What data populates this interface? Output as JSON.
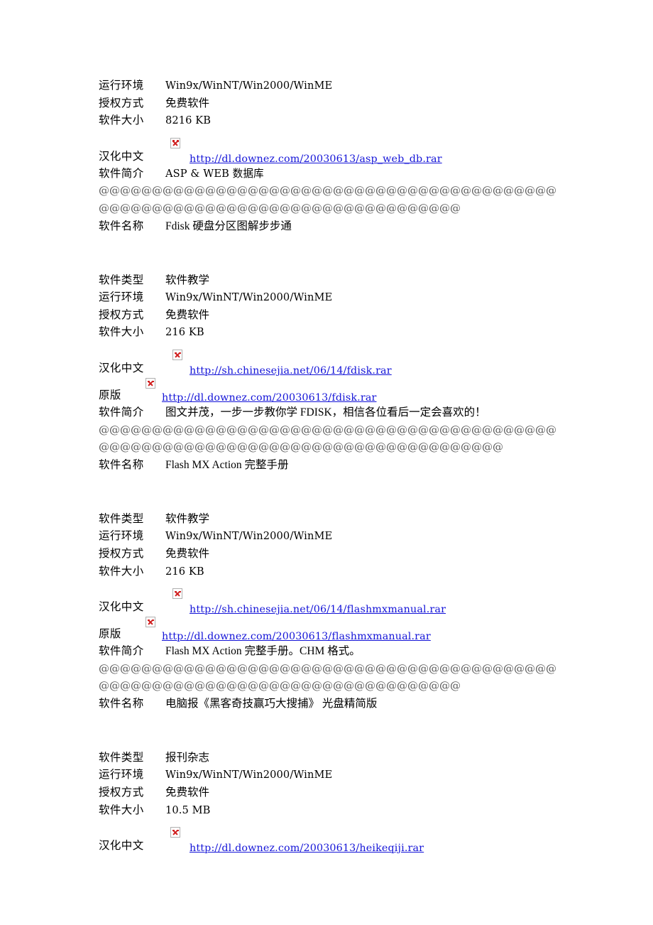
{
  "document": {
    "labels": {
      "name": "软件名称",
      "type": "软件类型",
      "env": "运行环境",
      "license": "授权方式",
      "size": "软件大小",
      "chinese": "汉化中文",
      "original": "原版",
      "intro": "软件简介"
    },
    "separator_line1": "@@@@@@@@@@@@@@@@@@@@@@@@@@@@@@@@@@@@@@@@@@@@@@@@@@@@@@@@@@@@@@@@",
    "separator_short_13": "@@@@@@@@@@@@@",
    "separator_short_17": "@@@@@@@@@@@@@@@@@",
    "entries": [
      {
        "id": "asp-web-db",
        "env": "Win9x/WinNT/Win2000/WinME",
        "license": "免费软件",
        "size": "8216  KB",
        "chinese_url": "http://dl.downez.com/20030613/asp_web_db.rar",
        "intro": "ASP  &  WEB  数据库",
        "separator_tail": "@@@@@@@@@@@@@"
      },
      {
        "id": "fdisk",
        "name": "Fdisk  硬盘分区图解步步通",
        "type": "软件教学",
        "env": "Win9x/WinNT/Win2000/WinME",
        "license": "免费软件",
        "size": "216  KB",
        "chinese_url": "http://sh.chinesejia.net/06/14/fdisk.rar",
        "original_url": "http://dl.downez.com/20030613/fdisk.rar",
        "intro": "图文并茂，一步一步教你学 FDISK，相信各位看后一定会喜欢的！",
        "separator_tail": "@@@@@@@@@@@@@@@@@"
      },
      {
        "id": "flashmxmanual",
        "name": "Flash  MX  Action 完整手册",
        "type": "软件教学",
        "env": "Win9x/WinNT/Win2000/WinME",
        "license": "免费软件",
        "size": "216  KB",
        "chinese_url": "http://sh.chinesejia.net/06/14/flashmxmanual.rar",
        "original_url": "http://dl.downez.com/20030613/flashmxmanual.rar",
        "intro": "Flash  MX  Action 完整手册。CHM 格式。",
        "separator_tail": "@@@@@@@@@@@@@"
      },
      {
        "id": "heikeqiji",
        "name": "电脑报《黑客奇技赢巧大搜捕》  光盘精简版",
        "type": "报刊杂志",
        "env": "Win9x/WinNT/Win2000/WinME",
        "license": "免费软件",
        "size": "10.5  MB",
        "chinese_url": "http://dl.downez.com/20030613/heikeqiji.rar"
      }
    ],
    "colors": {
      "link": "#1414d8",
      "text": "#000000",
      "separator": "#585858",
      "broken_icon_mark": "#d02020"
    },
    "icons": {
      "broken_image": "broken-image-icon"
    }
  }
}
